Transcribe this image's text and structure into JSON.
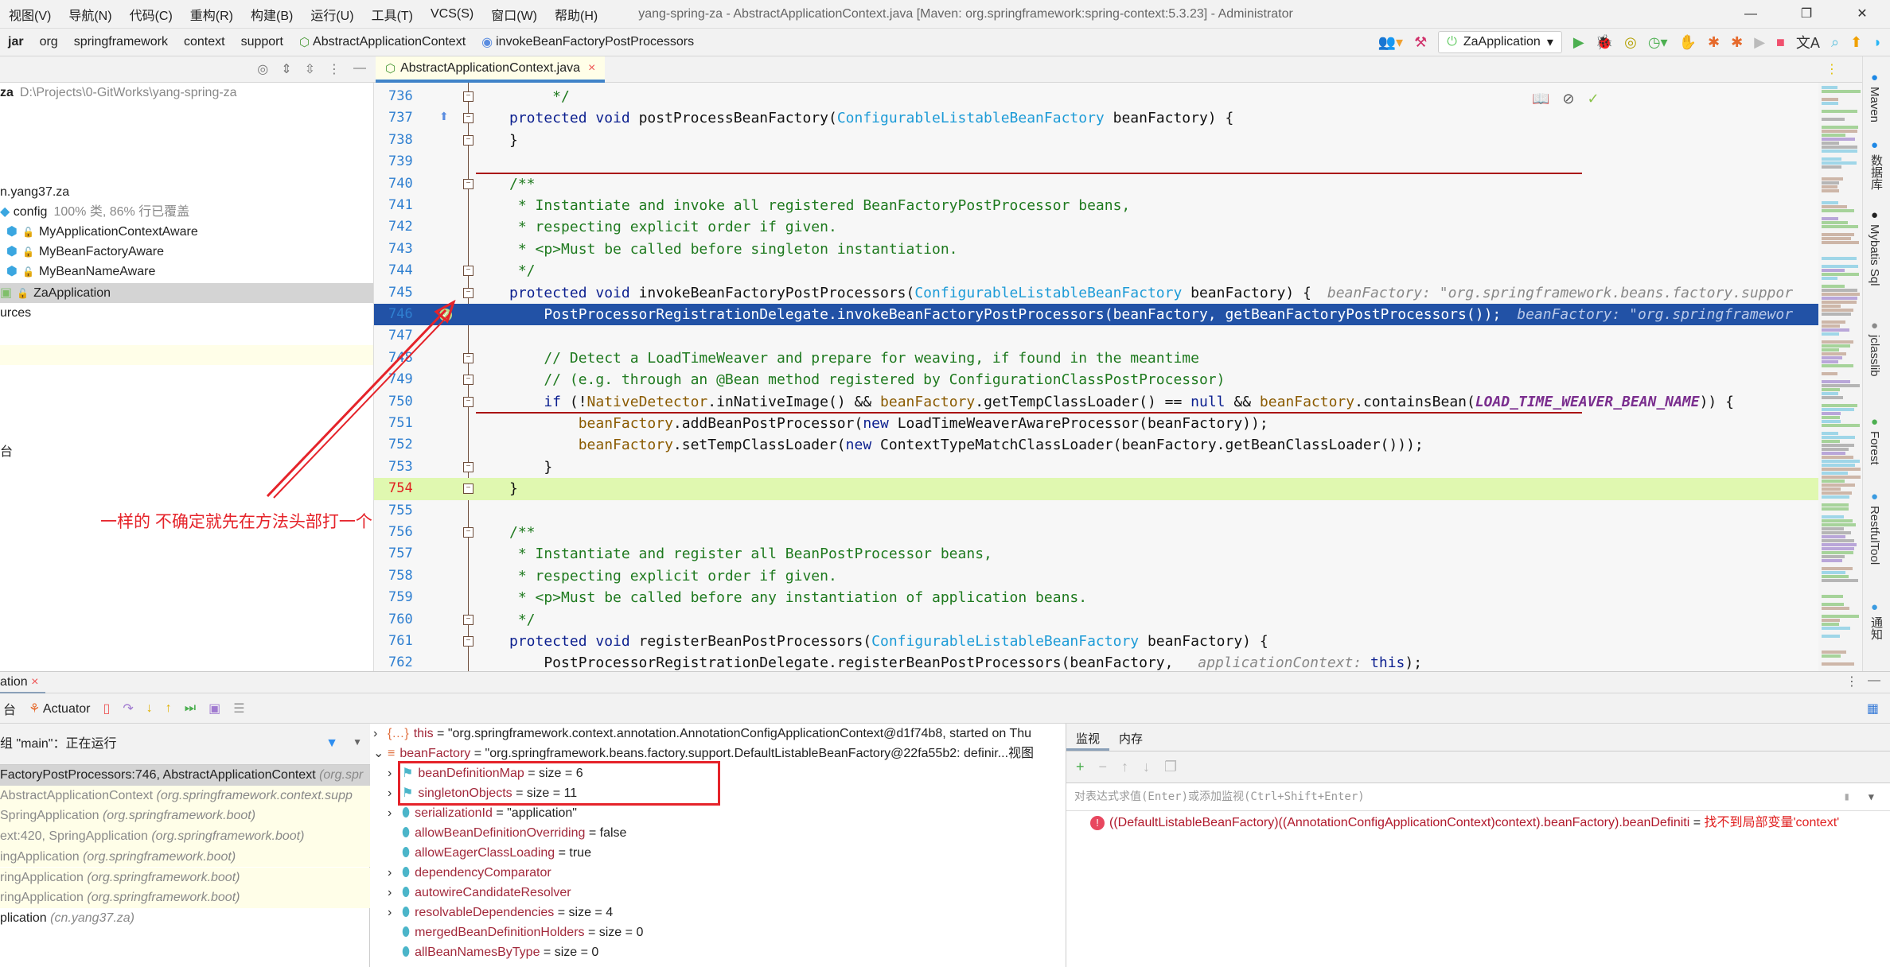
{
  "window": {
    "title": "yang-spring-za - AbstractApplicationContext.java [Maven: org.springframework:spring-context:5.3.23] - Administrator",
    "controls": [
      "—",
      "❐",
      "✕"
    ]
  },
  "menu": [
    "视图(V)",
    "导航(N)",
    "代码(C)",
    "重构(R)",
    "构建(B)",
    "运行(U)",
    "工具(T)",
    "VCS(S)",
    "窗口(W)",
    "帮助(H)"
  ],
  "breadcrumb": [
    "jar",
    "org",
    "springframework",
    "context",
    "support",
    "AbstractApplicationContext",
    "invokeBeanFactoryPostProcessors"
  ],
  "run": {
    "config": "ZaApplication"
  },
  "editor": {
    "tab": "AbstractApplicationContext.java",
    "lines": [
      {
        "n": "736",
        "s": [
          [
            "dc",
            "     */"
          ]
        ]
      },
      {
        "n": "737",
        "s": [
          [
            "kw",
            "protected void "
          ],
          [
            "pl",
            "postProcessBeanFactory("
          ],
          [
            "ty",
            "ConfigurableListableBeanFactory"
          ],
          [
            "pl",
            " beanFactory) {"
          ]
        ]
      },
      {
        "n": "738",
        "s": [
          [
            "pl",
            "}"
          ]
        ]
      },
      {
        "n": "739",
        "s": []
      },
      {
        "n": "740",
        "s": [
          [
            "dc",
            "/**"
          ]
        ]
      },
      {
        "n": "741",
        "s": [
          [
            "dc",
            " * Instantiate and invoke all registered BeanFactoryPostProcessor beans,"
          ]
        ]
      },
      {
        "n": "742",
        "s": [
          [
            "dc",
            " * respecting explicit order if given."
          ]
        ]
      },
      {
        "n": "743",
        "s": [
          [
            "dc",
            " * <p>Must be called before singleton instantiation."
          ]
        ]
      },
      {
        "n": "744",
        "s": [
          [
            "dc",
            " */"
          ]
        ]
      },
      {
        "n": "745",
        "s": [
          [
            "kw",
            "protected void "
          ],
          [
            "pl",
            "invokeBeanFactoryPostProcessors("
          ],
          [
            "ty",
            "ConfigurableListableBeanFactory"
          ],
          [
            "pl",
            " beanFactory) {"
          ],
          [
            "hint",
            "beanFactory: \"org.springframework.beans.factory.suppor"
          ]
        ]
      },
      {
        "n": "746",
        "s": [
          [
            "pl",
            "    PostProcessorRegistrationDelegate.invokeBeanFactoryPostProcessors(beanFactory, getBeanFactoryPostProcessors());"
          ],
          [
            "hint",
            "beanFactory: \"org.springframewor"
          ]
        ]
      },
      {
        "n": "747",
        "s": []
      },
      {
        "n": "748",
        "s": [
          [
            "cm",
            "    // Detect a LoadTimeWeaver and prepare for weaving, if found in the meantime"
          ]
        ]
      },
      {
        "n": "749",
        "s": [
          [
            "cm",
            "    // (e.g. through an @Bean method registered by ConfigurationClassPostProcessor)"
          ]
        ]
      },
      {
        "n": "750",
        "s": [
          [
            "kw",
            "    if "
          ],
          [
            "pl",
            "(!"
          ],
          [
            "fld",
            "NativeDetector"
          ],
          [
            "pl",
            ".inNativeImage() && "
          ],
          [
            "fld",
            "beanFactory"
          ],
          [
            "pl",
            ".getTempClassLoader() == "
          ],
          [
            "kw",
            "null"
          ],
          [
            "pl",
            " && "
          ],
          [
            "fld",
            "beanFactory"
          ],
          [
            "pl",
            ".containsBean("
          ],
          [
            "cst",
            "LOAD_TIME_WEAVER_BEAN_NAME"
          ],
          [
            "pl",
            ")) {"
          ]
        ]
      },
      {
        "n": "751",
        "s": [
          [
            "fld",
            "        beanFactory"
          ],
          [
            "pl",
            ".addBeanPostProcessor("
          ],
          [
            "kw",
            "new "
          ],
          [
            "pl",
            "LoadTimeWeaverAwareProcessor(beanFactory));"
          ]
        ]
      },
      {
        "n": "752",
        "s": [
          [
            "fld",
            "        beanFactory"
          ],
          [
            "pl",
            ".setTempClassLoader("
          ],
          [
            "kw",
            "new "
          ],
          [
            "pl",
            "ContextTypeMatchClassLoader(beanFactory.getBeanClassLoader()));"
          ]
        ]
      },
      {
        "n": "753",
        "s": [
          [
            "pl",
            "    }"
          ]
        ]
      },
      {
        "n": "754",
        "s": [
          [
            "pl",
            "}"
          ]
        ]
      },
      {
        "n": "755",
        "s": []
      },
      {
        "n": "756",
        "s": [
          [
            "dc",
            "/**"
          ]
        ]
      },
      {
        "n": "757",
        "s": [
          [
            "dc",
            " * Instantiate and register all BeanPostProcessor beans,"
          ]
        ]
      },
      {
        "n": "758",
        "s": [
          [
            "dc",
            " * respecting explicit order if given."
          ]
        ]
      },
      {
        "n": "759",
        "s": [
          [
            "dc",
            " * <p>Must be called before any instantiation of application beans."
          ]
        ]
      },
      {
        "n": "760",
        "s": [
          [
            "dc",
            " */"
          ]
        ]
      },
      {
        "n": "761",
        "s": [
          [
            "kw",
            "protected void "
          ],
          [
            "pl",
            "registerBeanPostProcessors("
          ],
          [
            "ty",
            "ConfigurableListableBeanFactory"
          ],
          [
            "pl",
            " beanFactory) {"
          ]
        ]
      },
      {
        "n": "762",
        "s": [
          [
            "pl",
            "    PostProcessorRegistrationDelegate.registerBeanPostProcessors(beanFactory, "
          ],
          [
            "hint",
            "applicationContext:"
          ],
          [
            "kw",
            " this"
          ],
          [
            "pl",
            ");"
          ]
        ]
      }
    ]
  },
  "project": {
    "root_name": "za",
    "root_path": "D:\\Projects\\0-GitWorks\\yang-spring-za",
    "package": "n.yang37.za",
    "config": "config",
    "config_coverage": "100% 类, 86% 行已覆盖",
    "classes": [
      "MyApplicationContextAware",
      "MyBeanFactoryAware",
      "MyBeanNameAware"
    ],
    "app": "ZaApplication",
    "resources": "urces",
    "console": "台"
  },
  "right_tools": [
    "Maven",
    "数据库",
    "Mybatis Sql",
    "jclasslib",
    "Forest",
    "RestfulTool",
    "通知"
  ],
  "debug": {
    "tab": "ation",
    "actuator": "Actuator",
    "thread": "组 \"main\"：正在运行",
    "frames": [
      [
        "FactoryPostProcessors:746, AbstractApplicationContext ",
        "(org.spr"
      ],
      [
        "AbstractApplicationContext ",
        "(org.springframework.context.supp"
      ],
      [
        "SpringApplication ",
        "(org.springframework.boot)"
      ],
      [
        "ext:420, SpringApplication ",
        "(org.springframework.boot)"
      ],
      [
        "ingApplication ",
        "(org.springframework.boot)"
      ],
      [
        "ringApplication ",
        "(org.springframework.boot)"
      ],
      [
        "ringApplication ",
        "(org.springframework.boot)"
      ],
      [
        "plication ",
        "(cn.yang37.za)"
      ]
    ],
    "vars": [
      {
        "name": "this",
        "val": " = \"org.springframework.context.annotation.AnnotationConfigApplicationContext@d1f74b8, started on Thu",
        "exp": ">",
        "lvl": 0
      },
      {
        "name": "beanFactory",
        "val": " = \"org.springframework.beans.factory.support.DefaultListableBeanFactory@22fa55b2: definir...视图",
        "exp": "v",
        "lvl": 0
      },
      {
        "name": "beanDefinitionMap",
        "val": " =  size = 6",
        "exp": ">",
        "lvl": 1
      },
      {
        "name": "singletonObjects",
        "val": " =  size = 11",
        "exp": ">",
        "lvl": 1
      },
      {
        "name": "serializationId",
        "val": " = \"application\"",
        "exp": ">",
        "lvl": 1
      },
      {
        "name": "allowBeanDefinitionOverriding",
        "val": " = false",
        "exp": "",
        "lvl": 1
      },
      {
        "name": "allowEagerClassLoading",
        "val": " = true",
        "exp": "",
        "lvl": 1
      },
      {
        "name": "dependencyComparator",
        "val": "",
        "exp": ">",
        "lvl": 1
      },
      {
        "name": "autowireCandidateResolver",
        "val": "",
        "exp": ">",
        "lvl": 1
      },
      {
        "name": "resolvableDependencies",
        "val": " =  size = 4",
        "exp": ">",
        "lvl": 1
      },
      {
        "name": "mergedBeanDefinitionHolders",
        "val": " =  size = 0",
        "exp": "",
        "lvl": 1
      },
      {
        "name": "allBeanNamesByType",
        "val": " =  size = 0",
        "exp": "",
        "lvl": 1
      }
    ],
    "watch_tabs": [
      "监视",
      "内存"
    ],
    "watch_placeholder": "对表达式求值(Enter)或添加监视(Ctrl+Shift+Enter)",
    "watch_expr": "((DefaultListableBeanFactory)((AnnotationConfigApplicationContext)context).beanFactory).beanDefiniti",
    "watch_eq": " = ",
    "watch_error": "找不到局部变量'context'"
  },
  "annotation": "一样的 不确定就先在方法头部打一个",
  "colors": {
    "accent": "#2252a6",
    "annotation": "#e5232a",
    "current_line": "#e0f8b0"
  }
}
